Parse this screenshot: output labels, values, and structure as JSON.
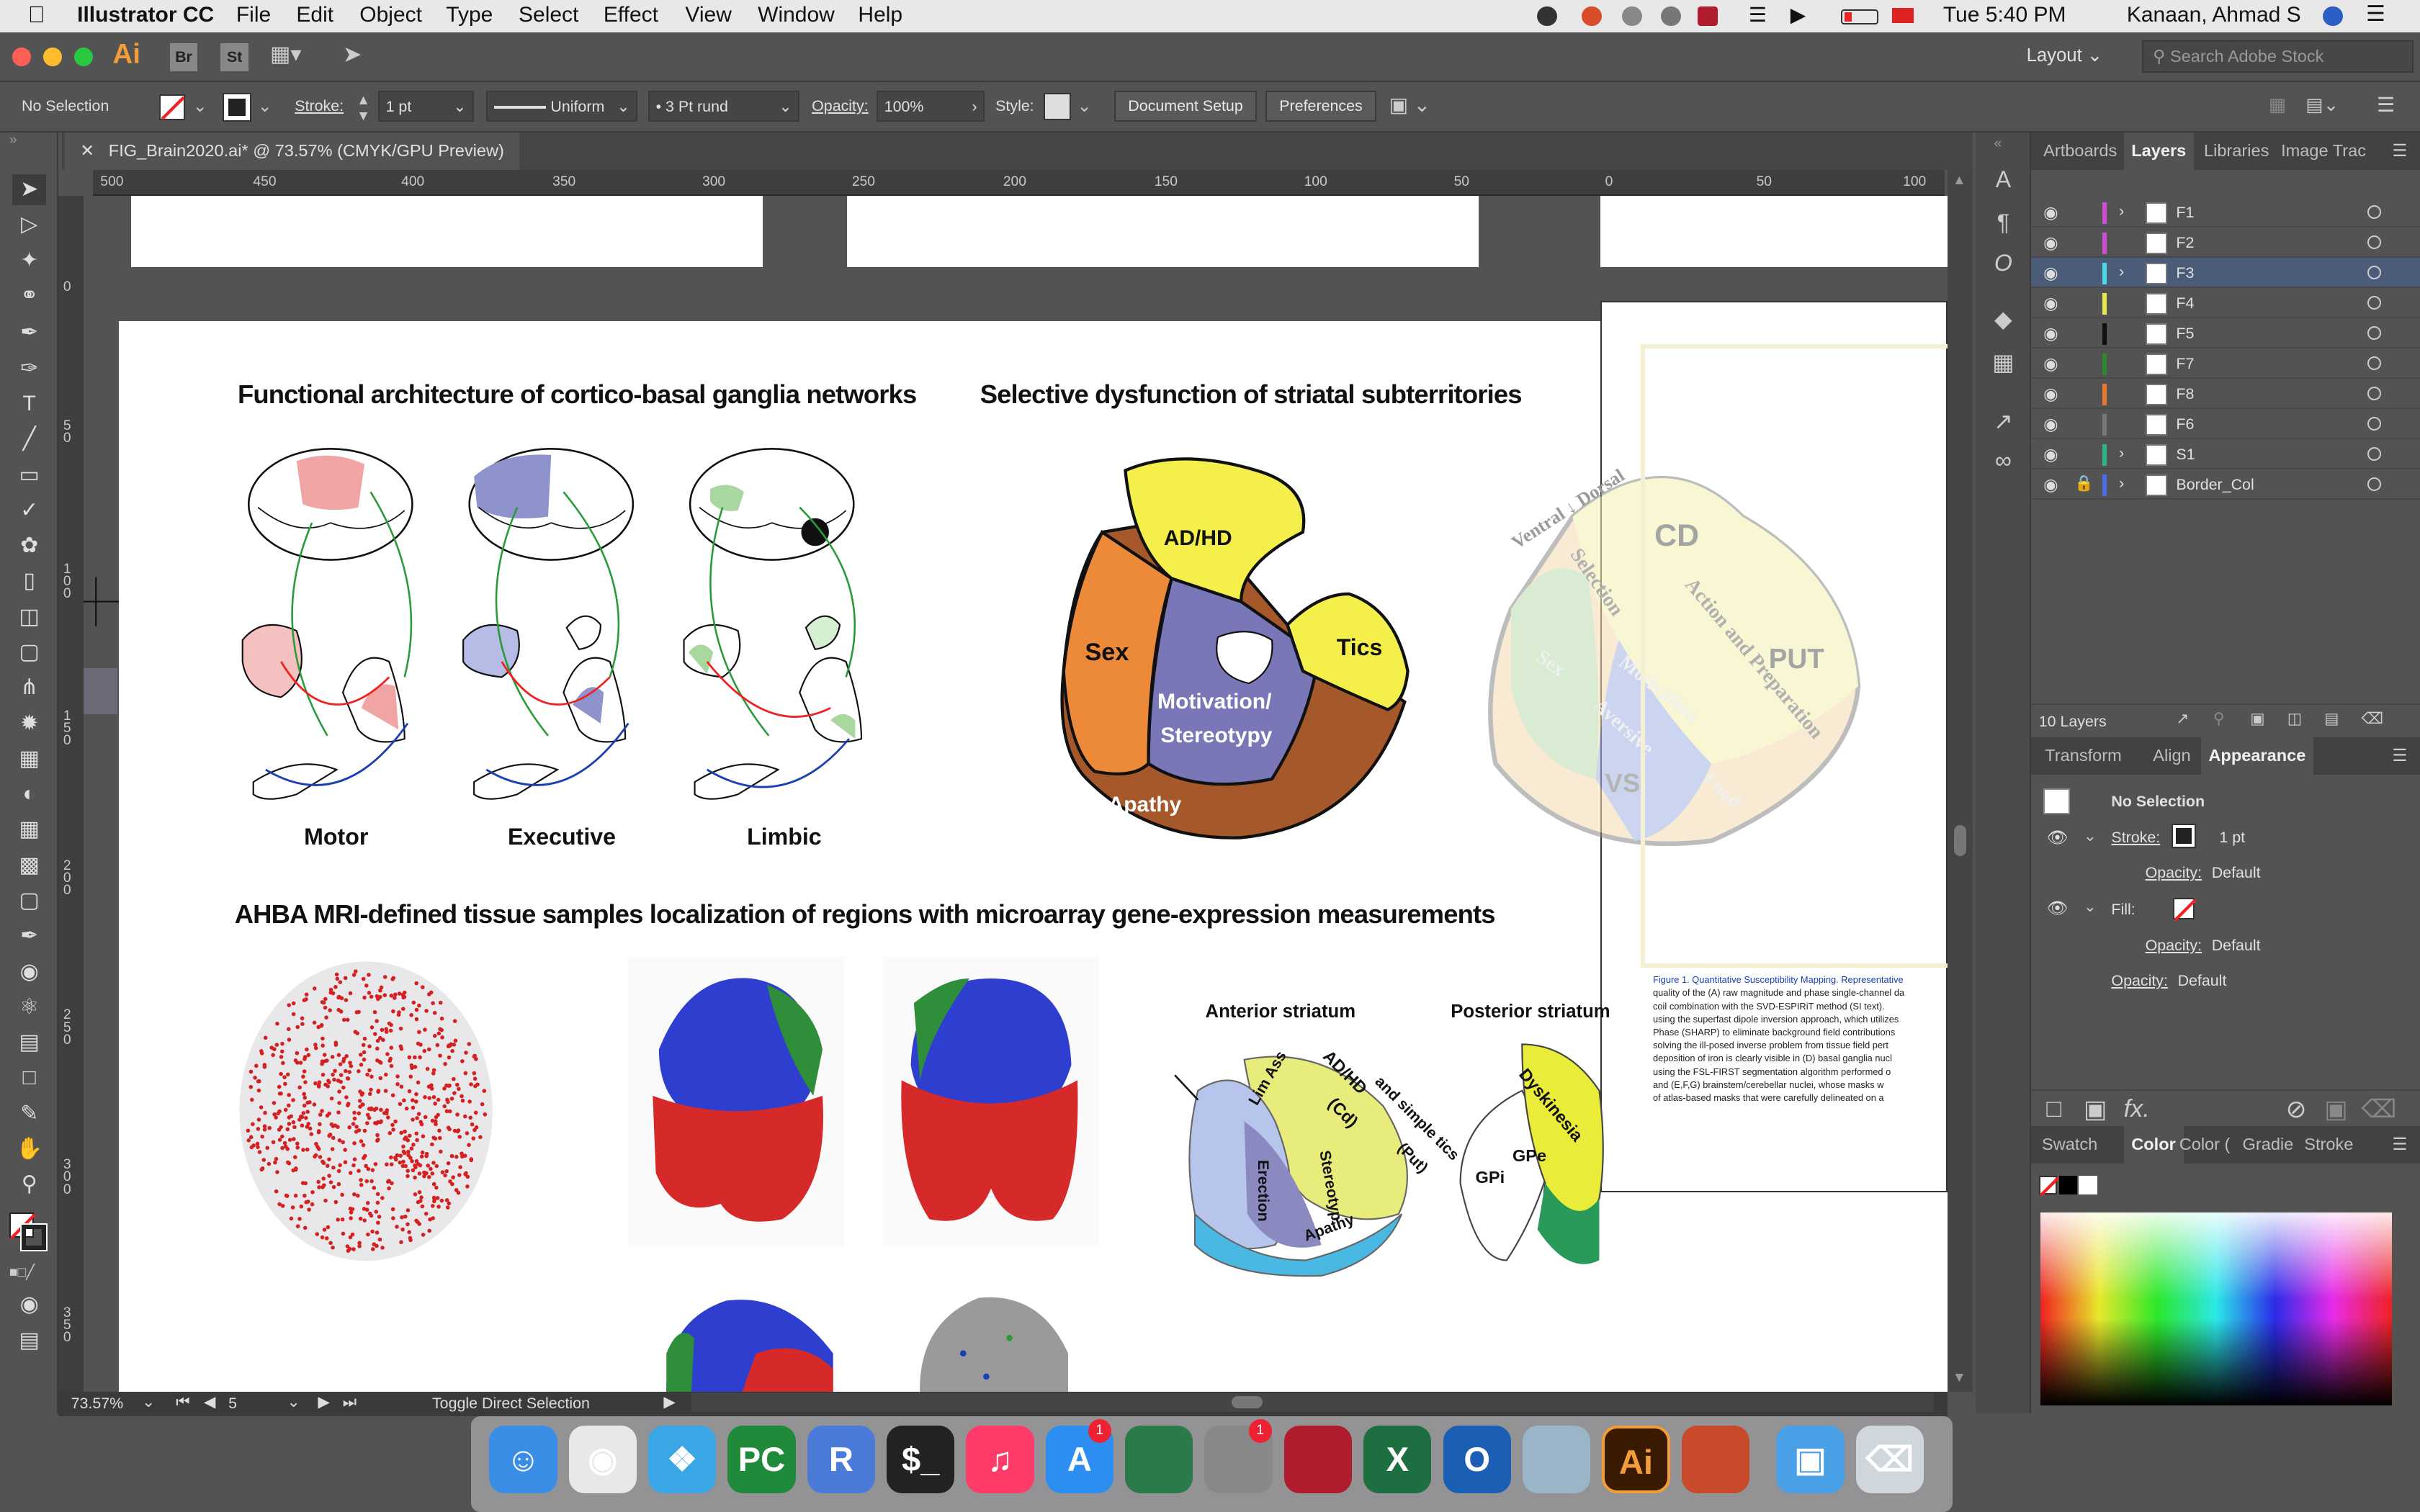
{
  "menubar": {
    "app": "Illustrator CC",
    "menus": [
      "File",
      "Edit",
      "Object",
      "Type",
      "Select",
      "Effect",
      "View",
      "Window",
      "Help"
    ],
    "time": "Tue 5:40 PM",
    "user": "Kanaan, Ahmad S"
  },
  "appbar": {
    "logo": "Ai",
    "br": "Br",
    "st": "St",
    "workspace": "Layout",
    "search_placeholder": "Search Adobe Stock"
  },
  "control": {
    "selection": "No Selection",
    "stroke_label": "Stroke:",
    "stroke_value": "1 pt",
    "profile": "Uniform",
    "brush": "3 Pt rund",
    "opacity_label": "Opacity:",
    "opacity_value": "100%",
    "style_label": "Style:",
    "doc_setup": "Document Setup",
    "preferences": "Preferences"
  },
  "document": {
    "tab_title": "FIG_Brain2020.ai* @ 73.57% (CMYK/GPU Preview)"
  },
  "ruler_h": [
    "500",
    "450",
    "400",
    "350",
    "300",
    "250",
    "200",
    "150",
    "100",
    "50",
    "0",
    "50",
    "100"
  ],
  "ruler_v": [
    "0",
    "50",
    "100",
    "150",
    "200",
    "250",
    "300",
    "350"
  ],
  "artwork": {
    "title1": "Functional architecture of cortico-basal ganglia networks",
    "title2": "Selective dysfunction of striatal subterritories",
    "label_motor": "Motor",
    "label_executive": "Executive",
    "label_limbic": "Limbic",
    "label_adhd": "AD/HD",
    "label_sex": "Sex",
    "label_tics": "Tics",
    "label_motivation": "Motivation/",
    "label_stereotypy": "Stereotypy",
    "label_apathy": "Apathy",
    "ghost_ventral": "Ventral ↓ Dorsal",
    "ghost_cd": "CD",
    "ghost_put": "PUT",
    "ghost_vs": "VS",
    "ghost_selection": "Selection",
    "ghost_action": "Action and Preparation",
    "ghost_sex": "Sex",
    "ghost_motivation": "Motivation",
    "ghost_aversive": "Aversive",
    "ghost_food": "Food",
    "title3": "AHBA MRI-defined tissue samples localization of  regions with microarray gene-expression measurements",
    "anterior": "Anterior striatum",
    "posterior": "Posterior striatum",
    "lim_ass": "Lim Ass",
    "ant_adhd": "AD/HD",
    "ant_cd": "(Cd)",
    "ant_simple": "and simple tics",
    "ant_put": "(Put)",
    "ant_erection": "Erection",
    "ant_stereotyp": "Stereotyp",
    "ant_apathy": "Apathy",
    "post_dyskinesia": "Dyskinesia",
    "post_gpe": "GPe",
    "post_gpi": "GPi",
    "caption_lines": [
      "Figure 1. Quantitative Susceptibility Mapping. Representative",
      "quality of the (A) raw magnitude and phase single-channel da",
      "coil combination with the SVD-ESPIRiT method (SI text).",
      "using the superfast dipole inversion approach, which utilizes",
      "Phase (SHARP) to eliminate background field contributions",
      "solving the ill-posed inverse problem from tissue field pert",
      "deposition of iron is clearly visible in (D) basal ganglia nucl",
      "using the FSL-FIRST segmentation algorithm performed o",
      "and (E,F,G) brainstem/cerebellar nuclei, whose masks w",
      "of atlas-based masks that were carefully delineated on a"
    ]
  },
  "status": {
    "zoom": "73.57%",
    "page": "5",
    "hint": "Toggle Direct Selection"
  },
  "layers_panel": {
    "tabs": [
      "Artboards",
      "Layers",
      "Libraries",
      "Image Trac"
    ],
    "layers": [
      {
        "name": "F1",
        "color": "#d14bd8",
        "expand": true
      },
      {
        "name": "F2",
        "color": "#d14bd8",
        "expand": false
      },
      {
        "name": "F3",
        "color": "#4bd8e6",
        "expand": true
      },
      {
        "name": "F4",
        "color": "#e8e84b",
        "expand": false
      },
      {
        "name": "F5",
        "color": "#111111",
        "expand": false
      },
      {
        "name": "F7",
        "color": "#2b8a2b",
        "expand": false
      },
      {
        "name": "F8",
        "color": "#e8782b",
        "expand": false
      },
      {
        "name": "F6",
        "color": "#777777",
        "expand": false
      },
      {
        "name": "S1",
        "color": "#2bb48a",
        "expand": true
      },
      {
        "name": "Border_Col",
        "color": "#4b6be8",
        "expand": true
      }
    ],
    "count": "10 Layers"
  },
  "appearance_panel": {
    "tabs": [
      "Transform",
      "Align",
      "Appearance"
    ],
    "selection": "No Selection",
    "stroke_label": "Stroke:",
    "stroke_value": "1 pt",
    "opacity_label": "Opacity:",
    "opacity_value": "Default",
    "fill_label": "Fill:",
    "fill_opacity_label": "Opacity:",
    "fill_opacity_value": "Default",
    "obj_opacity_label": "Opacity:",
    "obj_opacity_value": "Default"
  },
  "color_panel": {
    "tabs": [
      "Swatch",
      "Color",
      "Color (",
      "Gradie",
      "Stroke"
    ]
  },
  "dock": {
    "apps": [
      "Finder",
      "Chrome",
      "Safari",
      "PyCharm",
      "R",
      "Terminal",
      "Music",
      "App Store",
      "Network",
      "System Preferences",
      "Mendeley",
      "Excel",
      "Outlook",
      "Preview",
      "Illustrator",
      "Brain",
      "Folder",
      "Trash"
    ],
    "badge_appstore": "1",
    "badge_sysprefs": "1"
  }
}
